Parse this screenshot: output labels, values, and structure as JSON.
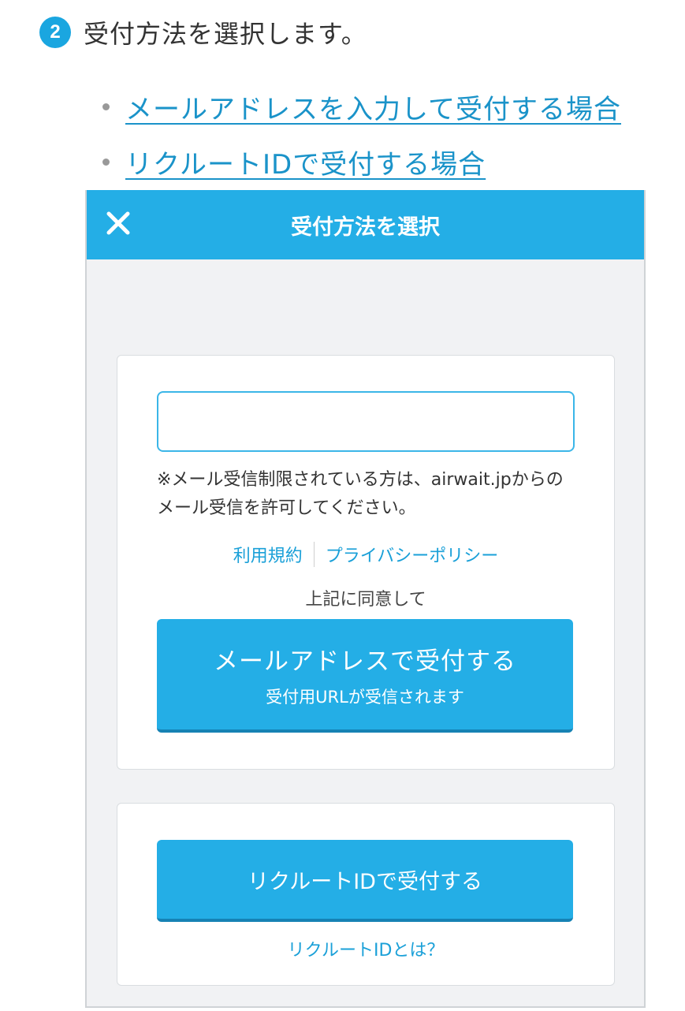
{
  "step": {
    "number": "2",
    "text": "受付方法を選択します。"
  },
  "links": [
    {
      "label": "メールアドレスを入力して受付する場合"
    },
    {
      "label": "リクルートIDで受付する場合"
    }
  ],
  "header": {
    "title": "受付方法を選択",
    "close_icon": "close-icon"
  },
  "email_card": {
    "input_value": "",
    "notice_line1": "※メール受信制限されている方は、airwait.jpからの",
    "notice_line2": "メール受信を許可してください。",
    "terms_link": "利用規約",
    "privacy_link": "プライバシーポリシー",
    "agree_text": "上記に同意して",
    "button_label": "メールアドレスで受付する",
    "button_sublabel": "受付用URLが受信されます"
  },
  "recruit_card": {
    "button_label": "リクルートIDで受付する",
    "help_link": "リクルートIDとは？"
  },
  "colors": {
    "accent": "#24aee6",
    "link": "#1a93c9",
    "background": "#f1f2f4"
  }
}
